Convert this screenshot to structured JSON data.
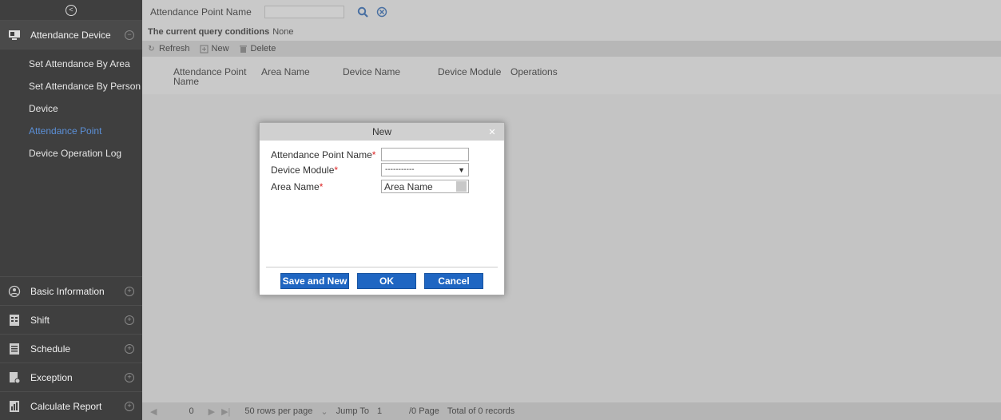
{
  "sidebar": {
    "collapse_icon": "collapse-circle-icon",
    "attendance_device": {
      "label": "Attendance Device",
      "items": [
        {
          "label": "Set Attendance By Area",
          "active": false
        },
        {
          "label": "Set Attendance By Person",
          "active": false
        },
        {
          "label": "Device",
          "active": false
        },
        {
          "label": "Attendance Point",
          "active": true
        },
        {
          "label": "Device Operation Log",
          "active": false
        }
      ]
    },
    "groups": [
      {
        "label": "Basic Information",
        "icon": "basic-info-icon"
      },
      {
        "label": "Shift",
        "icon": "shift-icon"
      },
      {
        "label": "Schedule",
        "icon": "schedule-icon"
      },
      {
        "label": "Exception",
        "icon": "exception-icon"
      },
      {
        "label": "Calculate Report",
        "icon": "report-icon"
      }
    ]
  },
  "search": {
    "label": "Attendance Point Name",
    "value": ""
  },
  "query": {
    "prefix": "The current query conditions",
    "value": "None"
  },
  "toolbar": {
    "refresh": "Refresh",
    "new": "New",
    "delete": "Delete"
  },
  "table": {
    "columns": [
      "Attendance Point Name",
      "Area Name",
      "Device Name",
      "Device Module",
      "Operations"
    ]
  },
  "pager": {
    "current": "0",
    "rows_per_page": "50 rows per page",
    "jump_to": "Jump To",
    "jump_value": "1",
    "pages": "/0 Page",
    "total": "Total of 0 records"
  },
  "dialog": {
    "title": "New",
    "fields": {
      "name_label": "Attendance Point Name",
      "module_label": "Device Module",
      "module_value": "-----------",
      "area_label": "Area Name",
      "area_value": "Area Name"
    },
    "buttons": {
      "save_new": "Save and New",
      "ok": "OK",
      "cancel": "Cancel"
    }
  },
  "colors": {
    "sidebar_bg": "#3f3f3f",
    "active_item": "#5b8fd6",
    "button_blue": "#1f66c2",
    "required": "#dd2222"
  }
}
